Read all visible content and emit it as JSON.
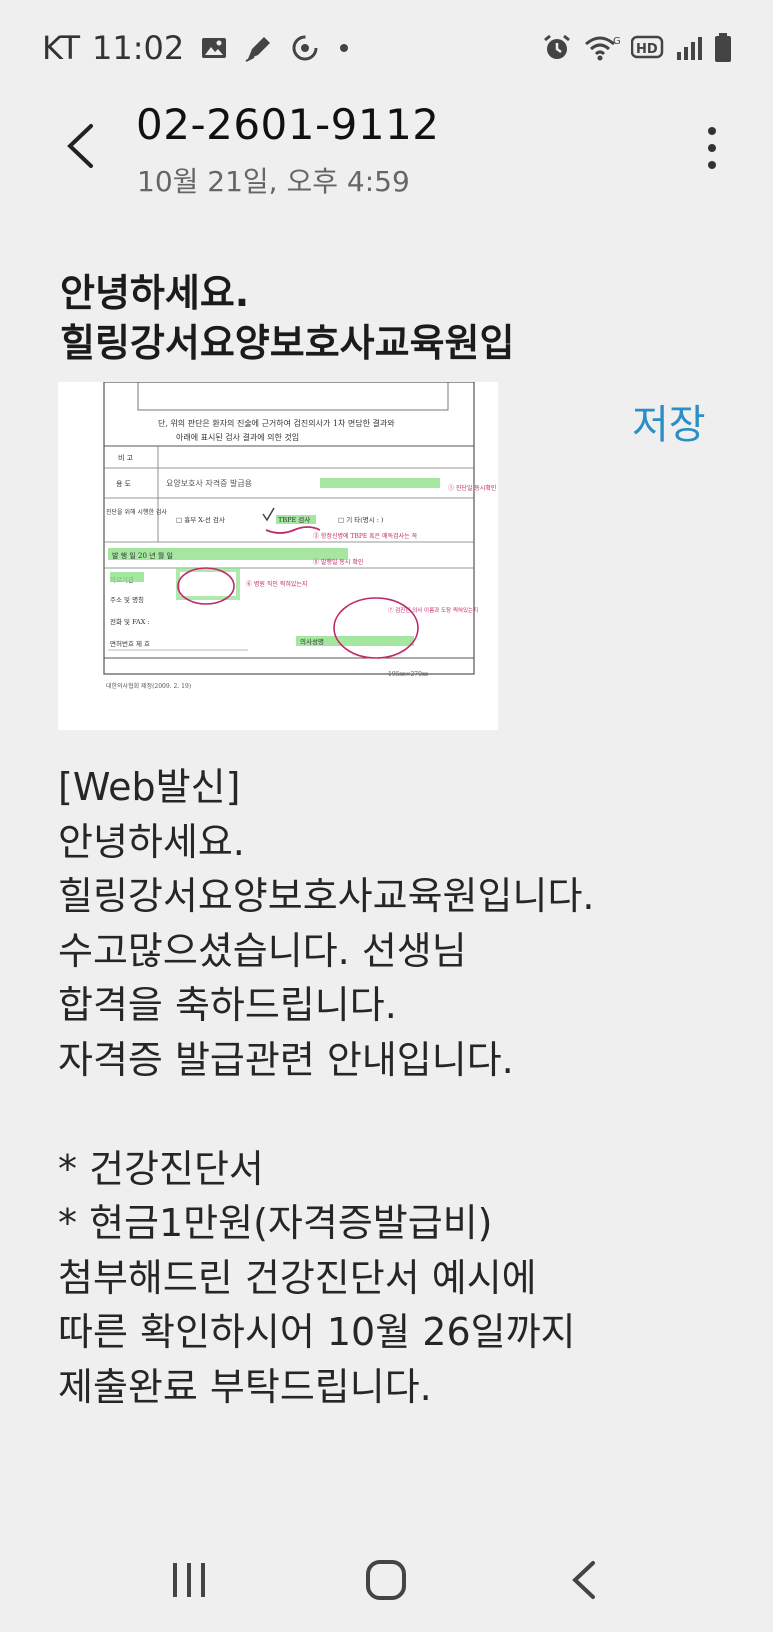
{
  "status_bar": {
    "carrier": "KT",
    "time": "11:02",
    "hd_label": "HD"
  },
  "header": {
    "sender": "02-2601-9112",
    "timestamp": "10월 21일, 오후 4:59"
  },
  "mms": {
    "subject_lines": [
      "안녕하세요.",
      "힐링강서요양보호사교육원입"
    ],
    "save_label": "저장",
    "attachment": {
      "caption1": "단, 위의 판단은 환자의 진술에 근거하여 검진의사가 1차 면담한 결과와",
      "caption2": "아래에 표시된 검사 결과에 의한 것임",
      "row_biko": "비 고",
      "row_yongdo": "용 도",
      "yongdo_value": "요양보호사 자격증 발급용",
      "row_exam": "진단을 위해 시행한 검사",
      "exam_opt1": "□ 흉부 X-선 검사",
      "exam_opt2": "TBPE 검사",
      "exam_opt3": "□ 기 타(명시 :          )",
      "date_label": "발 행 일        20   년   월   일",
      "row_hospital": "의료기관",
      "row_address": "주소 및 명칭",
      "row_phone": "전화 및 FAX :",
      "row_license": "면허번호 제        호",
      "doctor_label": "의사성명",
      "footer_left": "대한의사협회 제정(2009. 2. 19)",
      "footer_right": "195㎜×270㎜",
      "note1": "① 진단일 동시확인",
      "note2": "③ 항정신병에 TBPE 혹은 매독검사는 꼭",
      "note3": "⑤ 발행일 동시 확인",
      "note4": "⑥ 병원 직인 찍혀있는지",
      "note5": "⑦ 검진한 의사 이름과 도장 찍혀있는지"
    }
  },
  "message": {
    "lines": [
      "[Web발신]",
      "안녕하세요.",
      "힐링강서요양보호사교육원입니다.",
      "수고많으셨습니다. 선생님",
      "합격을 축하드립니다.",
      "자격증 발급관련 안내입니다.",
      "",
      "* 건강진단서",
      "* 현금1만원(자격증발급비)",
      "첨부해드린 건강진단서 예시에",
      "따른 확인하시어 10월 26일까지",
      "제출완료 부탁드립니다."
    ]
  },
  "icons": {
    "status_left": [
      "image-icon",
      "pen-icon",
      "sync-icon",
      "dot-icon"
    ],
    "status_right": [
      "alarm-icon",
      "wifi-icon",
      "hd-icon",
      "signal-icon",
      "battery-icon"
    ],
    "nav": [
      "recents-icon",
      "home-icon",
      "back-icon"
    ]
  }
}
